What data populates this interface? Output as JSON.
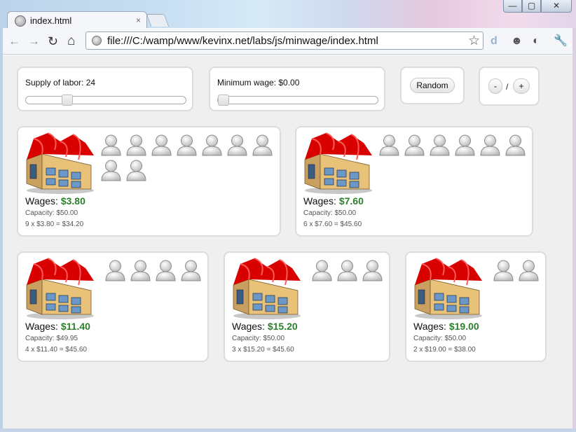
{
  "browser": {
    "tab_title": "index.html",
    "tab_close": "×",
    "url": "file:///C:/wamp/www/kevinx.net/labs/js/minwage/index.html",
    "window_buttons": [
      "—",
      "▢",
      "✕"
    ],
    "nav": {
      "back": "←",
      "forward": "→",
      "reload": "↻",
      "home": "⌂"
    },
    "star": "☆",
    "extensions": [
      "d",
      "☻",
      "◐",
      "🔧"
    ]
  },
  "controls": {
    "supply_label": "Supply of labor: 24",
    "supply_fraction": 0.24,
    "minwage_label": "Minimum wage: $0.00",
    "minwage_fraction": 0.0,
    "random_label": "Random",
    "minus_label": "-",
    "slash": "/",
    "plus_label": "+"
  },
  "factories": [
    {
      "wages_label": "Wages:",
      "wage": "$3.80",
      "capacity": "Capacity: $50.00",
      "formula": "9 x $3.80 = $34.20",
      "workers": 9
    },
    {
      "wages_label": "Wages:",
      "wage": "$7.60",
      "capacity": "Capacity: $50.00",
      "formula": "6 x $7.60 = $45.60",
      "workers": 6
    },
    {
      "wages_label": "Wages:",
      "wage": "$11.40",
      "capacity": "Capacity: $49.95",
      "formula": "4 x $11.40 = $45.60",
      "workers": 4
    },
    {
      "wages_label": "Wages:",
      "wage": "$15.20",
      "capacity": "Capacity: $50.00",
      "formula": "3 x $15.20 = $45.60",
      "workers": 3
    },
    {
      "wages_label": "Wages:",
      "wage": "$19.00",
      "capacity": "Capacity: $50.00",
      "formula": "2 x $19.00 = $38.00",
      "workers": 2
    }
  ],
  "colors": {
    "wage_accent": "#2b7f2b",
    "factory_roof": "#d90000",
    "factory_wall": "#e9c27a"
  },
  "icons": {
    "factory": "factory-icon",
    "worker": "worker-icon"
  }
}
